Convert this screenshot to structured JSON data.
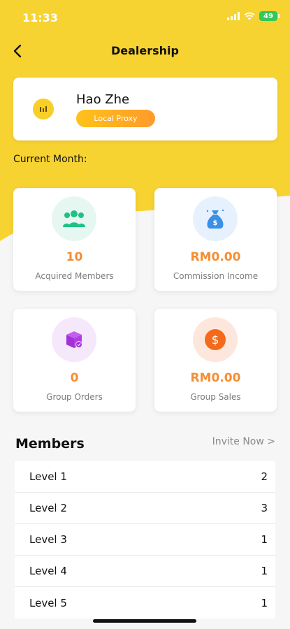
{
  "status_bar": {
    "time": "11:33",
    "battery": "49"
  },
  "nav": {
    "title": "Dealership",
    "back_icon": "chevron-left-icon"
  },
  "profile": {
    "name": "Hao Zhe",
    "badge": "Local Proxy",
    "avatar_icon": "bar-chart-icon"
  },
  "current_month_label": "Current Month:",
  "stats": [
    {
      "value": "10",
      "label": "Acquired Members",
      "icon": "members-icon",
      "circle_color": "#e6f7f1",
      "icon_color": "#1fc184"
    },
    {
      "value": "RM0.00",
      "label": "Commission Income",
      "icon": "money-bag-icon",
      "circle_color": "#e7f1fd",
      "icon_color": "#3a8fe6"
    },
    {
      "value": "0",
      "label": "Group Orders",
      "icon": "box-icon",
      "circle_color": "#f6e8fb",
      "icon_color": "#b23ee0"
    },
    {
      "value": "RM0.00",
      "label": "Group Sales",
      "icon": "dollar-coin-icon",
      "circle_color": "#fde7dc",
      "icon_color": "#f36a1d"
    }
  ],
  "members": {
    "title": "Members",
    "invite": "Invite Now >",
    "levels": [
      {
        "label": "Level 1",
        "count": "2"
      },
      {
        "label": "Level 2",
        "count": "3"
      },
      {
        "label": "Level 3",
        "count": "1"
      },
      {
        "label": "Level 4",
        "count": "1"
      },
      {
        "label": "Level 5",
        "count": "1"
      }
    ]
  },
  "colors": {
    "brand_yellow": "#f7d332",
    "accent_orange": "#f58d33"
  }
}
